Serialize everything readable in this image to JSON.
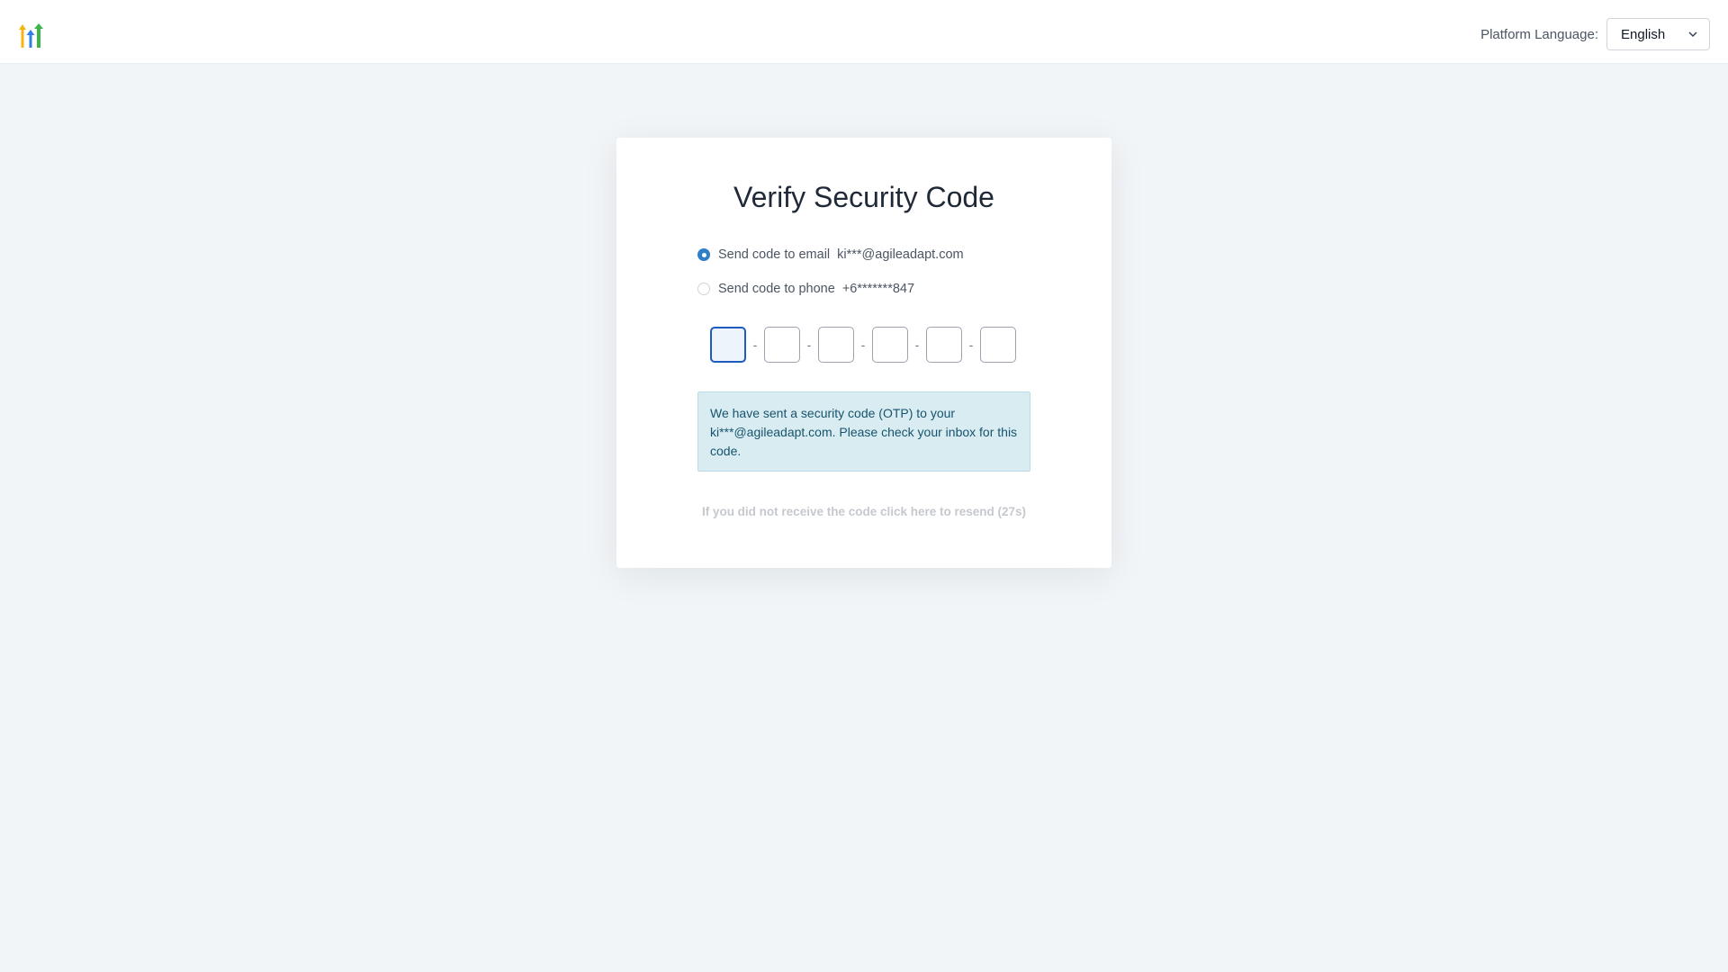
{
  "header": {
    "language_label": "Platform Language:",
    "language_value": "English",
    "logo_icon": "arrows-logo-icon"
  },
  "card": {
    "title": "Verify Security Code",
    "options": [
      {
        "label": "Send code to email",
        "value": "ki***@agileadapt.com",
        "selected": true
      },
      {
        "label": "Send code to phone",
        "value": "+6*******847",
        "selected": false
      }
    ],
    "otp": {
      "digits": [
        "",
        "",
        "",
        "",
        "",
        ""
      ],
      "separator": "-"
    },
    "info_message": "We have sent a security code (OTP) to your ki***@agileadapt.com. Please check your inbox for this code.",
    "resend_text": "If you did not receive the code click here to resend (27s)"
  },
  "colors": {
    "accent": "#2f80c7",
    "info_bg": "#d9ecf2",
    "info_text": "#16546d",
    "page_bg": "#f1f5f7"
  }
}
